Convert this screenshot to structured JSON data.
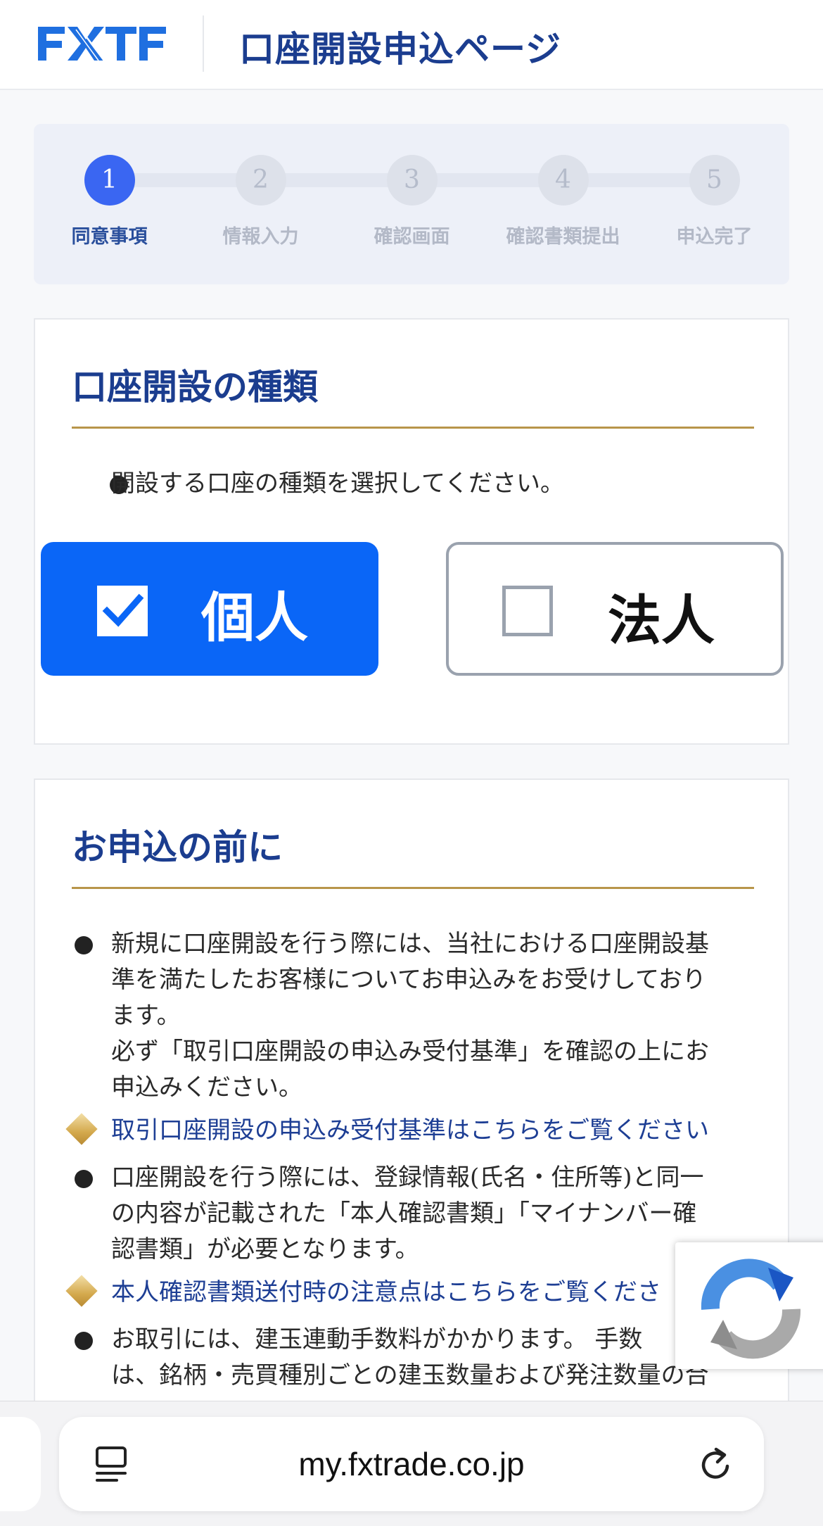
{
  "header": {
    "logo_text": "FXTF",
    "title": "口座開設申込ページ"
  },
  "stepper": {
    "steps": [
      {
        "number": "1",
        "label": "同意事項",
        "active": true
      },
      {
        "number": "2",
        "label": "情報入力",
        "active": false
      },
      {
        "number": "3",
        "label": "確認画面",
        "active": false
      },
      {
        "number": "4",
        "label": "確認書類提出",
        "active": false
      },
      {
        "number": "5",
        "label": "申込完了",
        "active": false
      }
    ],
    "active_color": "#3a66f2"
  },
  "account_type": {
    "title": "口座開設の種類",
    "instruction": "開設する口座の種類を選択してください。",
    "options": [
      {
        "label": "個人",
        "selected": true
      },
      {
        "label": "法人",
        "selected": false
      }
    ],
    "selected_color": "#0a66f7"
  },
  "before_apply": {
    "title": "お申込の前に",
    "bullet1_lines": [
      "新規に口座開設を行う際には、当社における口座開設基",
      "準を満たしたお客様についてお申込みをお受けしており",
      "ます。",
      "必ず「取引口座開設の申込み受付基準」を確認の上にお",
      "申込みください。"
    ],
    "link1": "取引口座開設の申込み受付基準はこちらをご覧ください",
    "bullet2_lines": [
      "口座開設を行う際には、登録情報(氏名・住所等)と同一",
      "の内容が記載された「本人確認書類」「マイナンバー確",
      "認書類」が必要となります。"
    ],
    "link2": "本人確認書類送付時の注意点はこちらをご覧くださ",
    "bullet3_lines": [
      "お取引には、建玉連動手数料がかかります。 手数",
      "は、銘柄・売買種別ごとの建玉数量および発注数量の合"
    ]
  },
  "browser": {
    "url": "my.fxtrade.co.jp"
  },
  "colors": {
    "brand_navy": "#1b3d8f",
    "gold_rule": "#b8954a",
    "logo_blue": "#1f6fe0"
  }
}
